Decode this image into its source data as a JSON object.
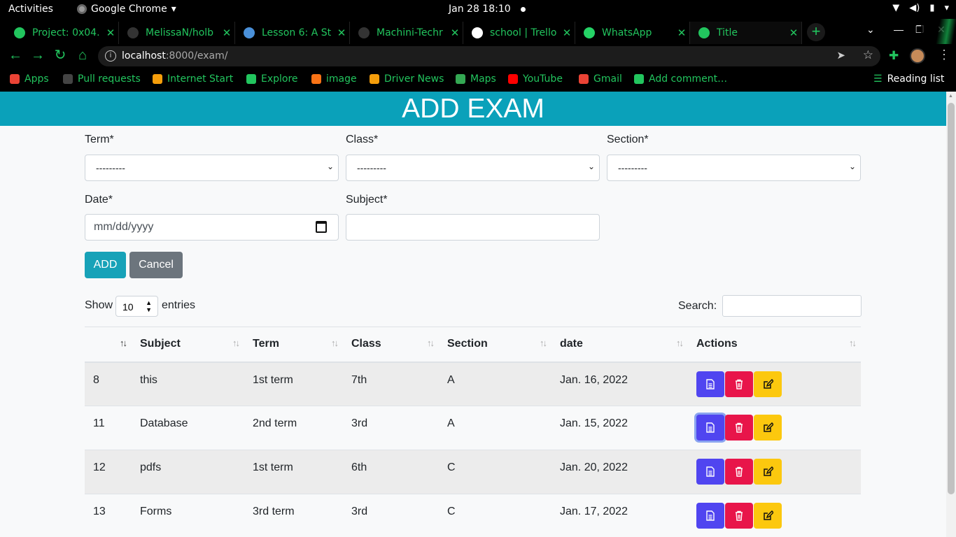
{
  "os": {
    "activities": "Activities",
    "app_name": "Google Chrome",
    "clock": "Jan 28  18:10"
  },
  "browser": {
    "tabs": [
      {
        "label": "Project: 0x04.",
        "color": "#22c55e"
      },
      {
        "label": "MelissaN/holb",
        "color": "#333"
      },
      {
        "label": "Lesson 6: A St",
        "color": "#4a90d9"
      },
      {
        "label": "Machini-Techr",
        "color": "#333"
      },
      {
        "label": "school | Trello",
        "color": "#fff"
      },
      {
        "label": "WhatsApp",
        "color": "#25d366"
      },
      {
        "label": "Title",
        "color": "#22c55e"
      }
    ],
    "url_host": "localhost",
    "url_path": ":8000/exam/",
    "bookmarks": [
      {
        "label": "Apps",
        "color": "#ea4335"
      },
      {
        "label": "Pull requests",
        "color": "#444"
      },
      {
        "label": "Internet Start",
        "color": "#f59e0b"
      },
      {
        "label": "Explore",
        "color": "#22c55e"
      },
      {
        "label": "image",
        "color": "#f97316"
      },
      {
        "label": "Driver News",
        "color": "#f59e0b"
      },
      {
        "label": "Maps",
        "color": "#34a853"
      },
      {
        "label": "YouTube",
        "color": "#ff0000"
      },
      {
        "label": "Gmail",
        "color": "#ea4335"
      },
      {
        "label": "Add comment…",
        "color": "#22c55e"
      }
    ],
    "reading_list": "Reading list"
  },
  "page": {
    "title": "ADD EXAM",
    "form": {
      "term_label": "Term*",
      "class_label": "Class*",
      "section_label": "Section*",
      "date_label": "Date*",
      "subject_label": "Subject*",
      "term_value": "---------",
      "class_value": "---------",
      "section_value": "---------",
      "date_placeholder": "mm/dd/yyyy",
      "subject_value": "",
      "add_label": "ADD",
      "cancel_label": "Cancel"
    },
    "table_controls": {
      "show_label": "Show",
      "entries_value": "10",
      "entries_label": "entries",
      "search_label": "Search:"
    },
    "table": {
      "columns": [
        "",
        "Subject",
        "Term",
        "Class",
        "Section",
        "date",
        "Actions"
      ],
      "rows": [
        {
          "id": "8",
          "subject": "this",
          "term": "1st term",
          "class": "7th",
          "section": "A",
          "date": "Jan. 16, 2022"
        },
        {
          "id": "11",
          "subject": "Database",
          "term": "2nd term",
          "class": "3rd",
          "section": "A",
          "date": "Jan. 15, 2022"
        },
        {
          "id": "12",
          "subject": "pdfs",
          "term": "1st term",
          "class": "6th",
          "section": "C",
          "date": "Jan. 20, 2022"
        },
        {
          "id": "13",
          "subject": "Forms",
          "term": "3rd term",
          "class": "3rd",
          "section": "C",
          "date": "Jan. 17, 2022"
        }
      ]
    }
  },
  "colors": {
    "header": "#0aa1ba",
    "add_button": "#17a2b8",
    "cancel_button": "#6c757d",
    "view_button": "#5045f0",
    "delete_button": "#e8154a",
    "edit_button": "#fcc80e"
  }
}
